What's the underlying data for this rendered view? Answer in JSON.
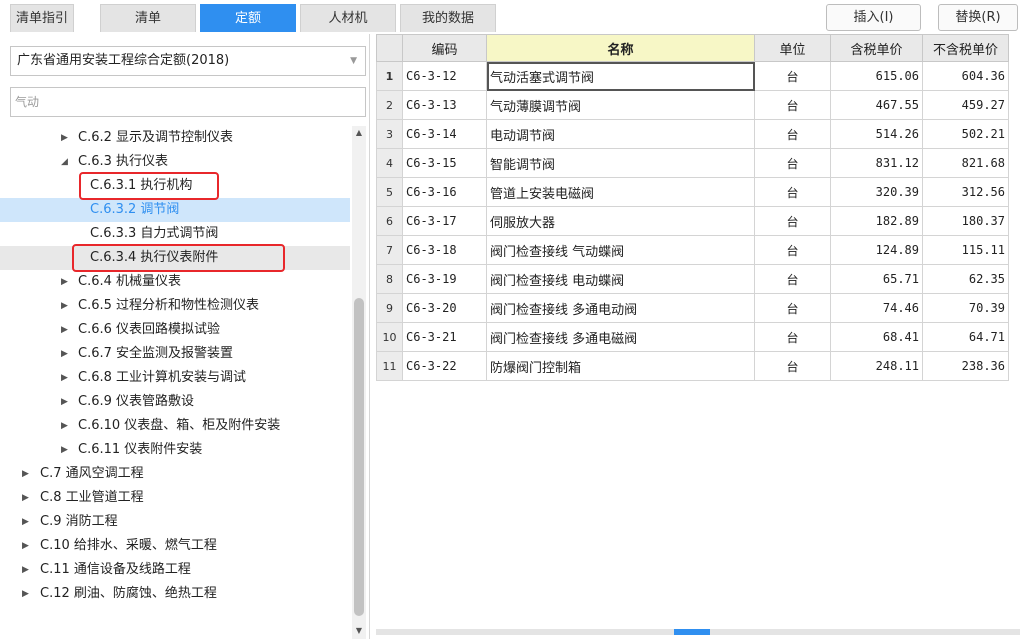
{
  "tabs": [
    {
      "label": "清单指引"
    },
    {
      "label": "清单"
    },
    {
      "label": "定额"
    },
    {
      "label": "人材机"
    },
    {
      "label": "我的数据"
    }
  ],
  "toolbar": {
    "insert_label": "插入(I)",
    "replace_label": "替换(R)"
  },
  "library": {
    "selected": "广东省通用安装工程综合定额(2018)"
  },
  "search": {
    "value": "气动"
  },
  "tree": [
    {
      "label": "C.6.2 显示及调节控制仪表",
      "level": 1,
      "arrow": "▶"
    },
    {
      "label": "C.6.3 执行仪表",
      "level": 1,
      "arrow": "◢"
    },
    {
      "label": "C.6.3.1 执行机构",
      "level": 2,
      "arrow": ""
    },
    {
      "label": "C.6.3.2 调节阀",
      "level": 2,
      "arrow": ""
    },
    {
      "label": "C.6.3.3 自力式调节阀",
      "level": 2,
      "arrow": ""
    },
    {
      "label": "C.6.3.4 执行仪表附件",
      "level": 2,
      "arrow": ""
    },
    {
      "label": "C.6.4 机械量仪表",
      "level": 1,
      "arrow": "▶"
    },
    {
      "label": "C.6.5 过程分析和物性检测仪表",
      "level": 1,
      "arrow": "▶"
    },
    {
      "label": "C.6.6 仪表回路模拟试验",
      "level": 1,
      "arrow": "▶"
    },
    {
      "label": "C.6.7 安全监测及报警装置",
      "level": 1,
      "arrow": "▶"
    },
    {
      "label": "C.6.8 工业计算机安装与调试",
      "level": 1,
      "arrow": "▶"
    },
    {
      "label": "C.6.9 仪表管路敷设",
      "level": 1,
      "arrow": "▶"
    },
    {
      "label": "C.6.10 仪表盘、箱、柜及附件安装",
      "level": 1,
      "arrow": "▶"
    },
    {
      "label": "C.6.11 仪表附件安装",
      "level": 1,
      "arrow": "▶"
    },
    {
      "label": "C.7 通风空调工程",
      "level": 0,
      "arrow": "▶"
    },
    {
      "label": "C.8 工业管道工程",
      "level": 0,
      "arrow": "▶"
    },
    {
      "label": "C.9 消防工程",
      "level": 0,
      "arrow": "▶"
    },
    {
      "label": "C.10 给排水、采暖、燃气工程",
      "level": 0,
      "arrow": "▶"
    },
    {
      "label": "C.11 通信设备及线路工程",
      "level": 0,
      "arrow": "▶"
    },
    {
      "label": "C.12 刷油、防腐蚀、绝热工程",
      "level": 0,
      "arrow": "▶"
    }
  ],
  "table": {
    "headers": {
      "code": "编码",
      "name": "名称",
      "unit": "单位",
      "price_tax": "含税单价",
      "price_notax": "不含税单价"
    },
    "rows": [
      {
        "idx": "1",
        "code": "C6-3-12",
        "name": "气动活塞式调节阀",
        "unit": "台",
        "price_tax": "615.06",
        "price_notax": "604.36"
      },
      {
        "idx": "2",
        "code": "C6-3-13",
        "name": "气动薄膜调节阀",
        "unit": "台",
        "price_tax": "467.55",
        "price_notax": "459.27"
      },
      {
        "idx": "3",
        "code": "C6-3-14",
        "name": "电动调节阀",
        "unit": "台",
        "price_tax": "514.26",
        "price_notax": "502.21"
      },
      {
        "idx": "4",
        "code": "C6-3-15",
        "name": "智能调节阀",
        "unit": "台",
        "price_tax": "831.12",
        "price_notax": "821.68"
      },
      {
        "idx": "5",
        "code": "C6-3-16",
        "name": "管道上安装电磁阀",
        "unit": "台",
        "price_tax": "320.39",
        "price_notax": "312.56"
      },
      {
        "idx": "6",
        "code": "C6-3-17",
        "name": "伺服放大器",
        "unit": "台",
        "price_tax": "182.89",
        "price_notax": "180.37"
      },
      {
        "idx": "7",
        "code": "C6-3-18",
        "name": "阀门检查接线 气动蝶阀",
        "unit": "台",
        "price_tax": "124.89",
        "price_notax": "115.11"
      },
      {
        "idx": "8",
        "code": "C6-3-19",
        "name": "阀门检查接线 电动蝶阀",
        "unit": "台",
        "price_tax": "65.71",
        "price_notax": "62.35"
      },
      {
        "idx": "9",
        "code": "C6-3-20",
        "name": "阀门检查接线 多通电动阀",
        "unit": "台",
        "price_tax": "74.46",
        "price_notax": "70.39"
      },
      {
        "idx": "10",
        "code": "C6-3-21",
        "name": "阀门检查接线 多通电磁阀",
        "unit": "台",
        "price_tax": "68.41",
        "price_notax": "64.71"
      },
      {
        "idx": "11",
        "code": "C6-3-22",
        "name": "防爆阀门控制箱",
        "unit": "台",
        "price_tax": "248.11",
        "price_notax": "238.36"
      }
    ]
  },
  "icons": {
    "dropdown": "chevron-down-icon",
    "collapsed": "triangle-right-icon",
    "expanded": "triangle-down-icon"
  },
  "colors": {
    "accent": "#2f8ff0",
    "highlight_box": "#e8272b",
    "selected_bg": "#cfe6fb"
  }
}
